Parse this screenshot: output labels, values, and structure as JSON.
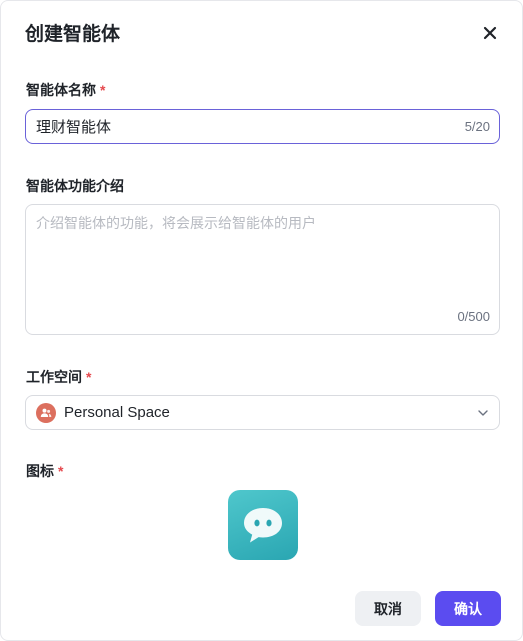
{
  "dialog": {
    "title": "创建智能体",
    "confirm_label": "确认",
    "cancel_label": "取消"
  },
  "name_field": {
    "label": "智能体名称",
    "required_mark": "*",
    "value": "理财智能体",
    "counter": "5/20"
  },
  "description_field": {
    "label": "智能体功能介绍",
    "placeholder": "介绍智能体的功能，将会展示给智能体的用户",
    "counter": "0/500"
  },
  "workspace_field": {
    "label": "工作空间",
    "required_mark": "*",
    "selected": "Personal Space",
    "avatar_icon": "users-icon",
    "avatar_color": "#dc6f5e"
  },
  "icon_field": {
    "label": "图标",
    "required_mark": "*",
    "icon": "chat-bubble-icon"
  },
  "colors": {
    "primary": "#5b4cf0",
    "required": "#e5484d",
    "focus_border": "#6a62d9"
  }
}
